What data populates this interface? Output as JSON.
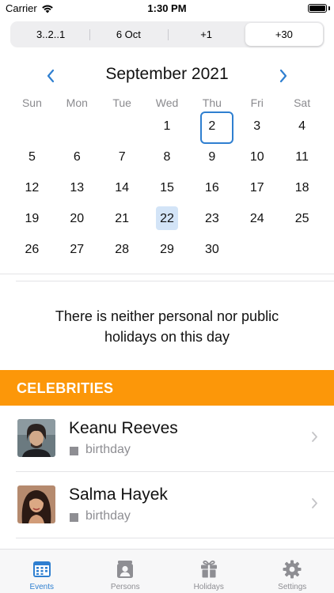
{
  "status_bar": {
    "carrier": "Carrier",
    "time": "1:30 PM"
  },
  "segments": [
    {
      "label": "3..2..1"
    },
    {
      "label": "6 Oct"
    },
    {
      "label": "+1"
    },
    {
      "label": "+30",
      "selected": true
    }
  ],
  "calendar": {
    "month_title": "September 2021",
    "weekdays": [
      "Sun",
      "Mon",
      "Tue",
      "Wed",
      "Thu",
      "Fri",
      "Sat"
    ],
    "weeks": [
      [
        "",
        "",
        "",
        "1",
        "2",
        "3",
        "4"
      ],
      [
        "5",
        "6",
        "7",
        "8",
        "9",
        "10",
        "11"
      ],
      [
        "12",
        "13",
        "14",
        "15",
        "16",
        "17",
        "18"
      ],
      [
        "19",
        "20",
        "21",
        "22",
        "23",
        "24",
        "25"
      ],
      [
        "26",
        "27",
        "28",
        "29",
        "30",
        "",
        ""
      ]
    ],
    "today": "2",
    "selected": "22"
  },
  "holiday_message": "There is neither personal nor public holidays on this day",
  "celebrities": {
    "title": "CELEBRITIES",
    "items": [
      {
        "name": "Keanu Reeves",
        "event": "birthday"
      },
      {
        "name": "Salma Hayek",
        "event": "birthday"
      }
    ]
  },
  "tabs": [
    {
      "label": "Events",
      "icon": "calendar-icon",
      "active": true
    },
    {
      "label": "Persons",
      "icon": "person-icon"
    },
    {
      "label": "Holidays",
      "icon": "gift-icon"
    },
    {
      "label": "Settings",
      "icon": "gear-icon"
    }
  ],
  "colors": {
    "accent": "#2f7fd0",
    "section_header": "#fc9709",
    "selected_day_bg": "#d3e4f7",
    "secondary_text": "#8e8e93"
  }
}
